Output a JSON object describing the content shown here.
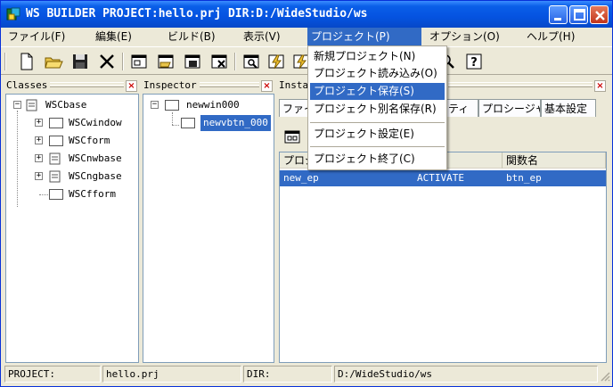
{
  "window": {
    "title": "WS BUILDER PROJECT:hello.prj DIR:D:/WideStudio/ws"
  },
  "menubar": {
    "items": [
      {
        "label": "ファイル(F)"
      },
      {
        "label": "編集(E)"
      },
      {
        "label": "ビルド(B)"
      },
      {
        "label": "表示(V)"
      },
      {
        "label": "プロジェクト(P)"
      },
      {
        "label": "オプション(O)"
      },
      {
        "label": "ヘルプ(H)"
      }
    ],
    "active_index": 4
  },
  "project_menu": {
    "items": [
      {
        "label": "新規プロジェクト(N)"
      },
      {
        "label": "プロジェクト読み込み(O)"
      },
      {
        "label": "プロジェクト保存(S)"
      },
      {
        "label": "プロジェクト別名保存(R)"
      },
      {
        "label": "プロジェクト設定(E)"
      },
      {
        "label": "プロジェクト終了(C)"
      }
    ],
    "highlighted_index": 2
  },
  "toolbar": {
    "buttons": [
      "new-file-icon",
      "open-folder-icon",
      "save-disk-icon",
      "cut-icon",
      "new-window-icon",
      "open-window-icon",
      "save-window-icon",
      "close-window-icon",
      "search-window-icon",
      "build-icon",
      "run-icon",
      "find-icon",
      "help-icon"
    ],
    "help_glyph": "?"
  },
  "classes_pane": {
    "title": "Classes",
    "items": [
      {
        "label": "WSCbase",
        "level": 0,
        "expanded": true
      },
      {
        "label": "WSCwindow",
        "level": 1,
        "expanded": false
      },
      {
        "label": "WSCform",
        "level": 1,
        "expanded": false
      },
      {
        "label": "WSCnwbase",
        "level": 1,
        "expanded": false
      },
      {
        "label": "WSCngbase",
        "level": 1,
        "expanded": false
      },
      {
        "label": "WSCfform",
        "level": 1,
        "expanded": null
      }
    ]
  },
  "inspector_pane": {
    "title": "Inspector",
    "items": [
      {
        "label": "newwin000",
        "expanded": true
      },
      {
        "label": "newvbtn_000",
        "selected": true
      }
    ]
  },
  "instance_pane": {
    "title": "Instan",
    "tabs": [
      {
        "label": "ファイ"
      },
      {
        "label": "ティ"
      },
      {
        "label": "プロシージャ"
      },
      {
        "label": "基本設定"
      }
    ],
    "columns": [
      "プロジ",
      "",
      "関数名"
    ],
    "rows": [
      {
        "name": "new_ep",
        "trigger": "ACTIVATE",
        "function": "btn_ep"
      }
    ]
  },
  "statusbar": {
    "project_label": "PROJECT:",
    "project_value": "hello.prj",
    "dir_label": "DIR:",
    "dir_value": "D:/WideStudio/ws"
  },
  "colors": {
    "selection": "#316ac5",
    "title_bar": "#0553e0",
    "face": "#ece9d8"
  }
}
